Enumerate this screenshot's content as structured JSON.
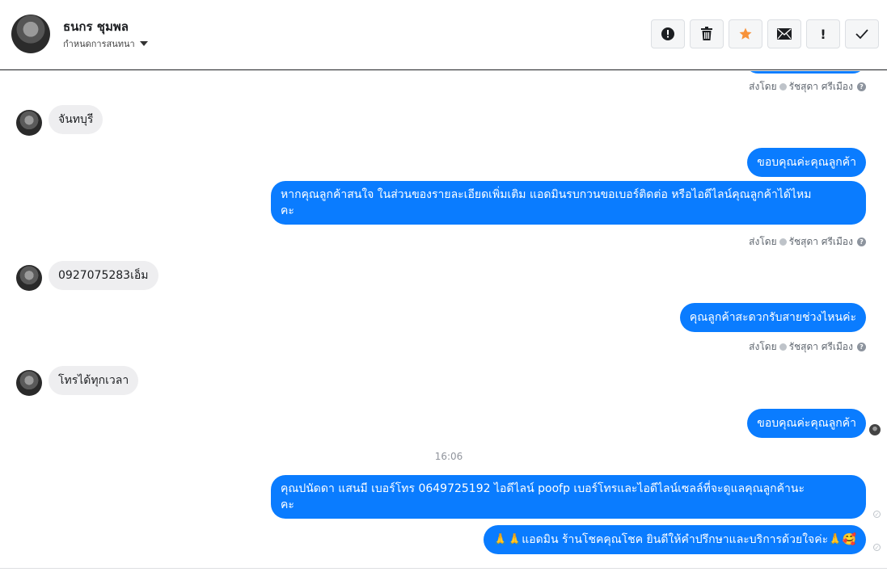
{
  "header": {
    "name": "ธนกร ชุมพล",
    "subtitle": "กำหนดการสนทนา",
    "toolbar": [
      {
        "icon": "alert-circle-icon",
        "label": ""
      },
      {
        "icon": "trash-icon",
        "label": ""
      },
      {
        "icon": "star-icon",
        "label": ""
      },
      {
        "icon": "envelope-icon",
        "label": ""
      },
      {
        "icon": "exclamation-icon",
        "label": "!"
      },
      {
        "icon": "check-icon",
        "label": ""
      }
    ]
  },
  "sent_by": {
    "prefix": "ส่งโดย",
    "agent": "รัชสุดา ศรีเมือง",
    "help": "?"
  },
  "messages": {
    "m1": "จันทบุรี",
    "m2": "ขอบคุณค่ะคุณลูกค้า",
    "m3_line1": "หากคุณลูกค้าสนใจ ในส่วนของรายละเอียดเพิ่มเติม แอดมินรบกวนขอเบอร์ติดต่อ หรือไอดีไลน์คุณลูกค้าได้ไหม",
    "m3_line2": "คะ",
    "m4": "0927075283เอ็ม",
    "m5": "คุณลูกค้าสะดวกรับสายช่วงไหนค่ะ",
    "m6": "โทรได้ทุกเวลา",
    "m7": "ขอบคุณค่ะคุณลูกค้า",
    "time": "16:06",
    "m8_line1": "คุณปนัดดา แสนมี   เบอร์โทร 0649725192  ไอดีไลน์ poofp  เบอร์โทรและไอดีไลน์เซลล์ที่จะดูแลคุณลูกค้านะ",
    "m8_line2": "คะ",
    "m9": "🙏🙏แอดมิน ร้านโชคคุณโชค ยินดีให้คำปรึกษาและบริการด้วยใจค่ะ🙏🥰"
  },
  "colors": {
    "outgoing": "#0a7cff",
    "incoming": "#eeeef0",
    "star": "#f7923a"
  }
}
